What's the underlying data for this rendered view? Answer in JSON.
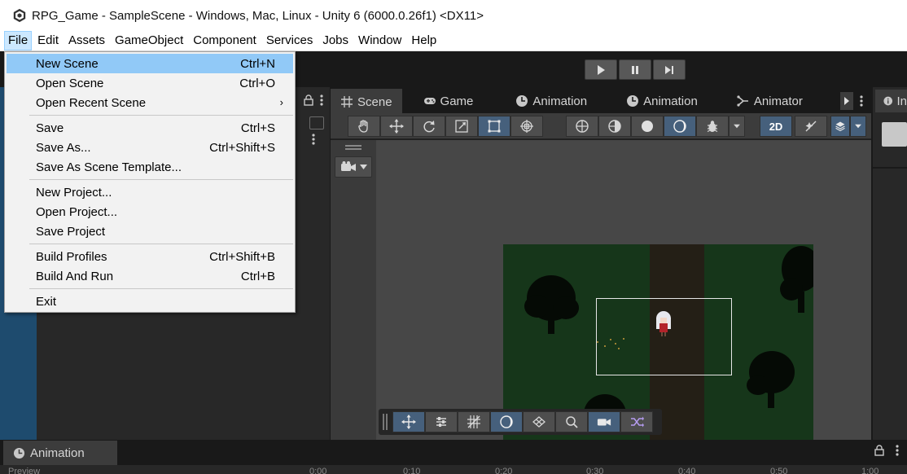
{
  "window": {
    "title": "RPG_Game - SampleScene - Windows, Mac, Linux - Unity 6 (6000.0.26f1) <DX11>"
  },
  "menubar": {
    "items": [
      "File",
      "Edit",
      "Assets",
      "GameObject",
      "Component",
      "Services",
      "Jobs",
      "Window",
      "Help"
    ]
  },
  "file_menu": {
    "groups": [
      [
        {
          "label": "New Scene",
          "shortcut": "Ctrl+N"
        },
        {
          "label": "Open Scene",
          "shortcut": "Ctrl+O"
        },
        {
          "label": "Open Recent Scene",
          "shortcut": ""
        }
      ],
      [
        {
          "label": "Save",
          "shortcut": "Ctrl+S"
        },
        {
          "label": "Save As...",
          "shortcut": "Ctrl+Shift+S"
        },
        {
          "label": "Save As Scene Template...",
          "shortcut": ""
        }
      ],
      [
        {
          "label": "New Project...",
          "shortcut": ""
        },
        {
          "label": "Open Project...",
          "shortcut": ""
        },
        {
          "label": "Save Project",
          "shortcut": ""
        }
      ],
      [
        {
          "label": "Build Profiles",
          "shortcut": "Ctrl+Shift+B"
        },
        {
          "label": "Build And Run",
          "shortcut": "Ctrl+B"
        }
      ],
      [
        {
          "label": "Exit",
          "shortcut": ""
        }
      ]
    ],
    "submenu_arrow": "›"
  },
  "scene_tabs": [
    {
      "label": "Scene",
      "icon": "grid-icon"
    },
    {
      "label": "Game",
      "icon": "gamepad-icon"
    },
    {
      "label": "Animation",
      "icon": "animation-clock-icon"
    },
    {
      "label": "Animation",
      "icon": "animation-clock-icon"
    },
    {
      "label": "Animator",
      "icon": "animator-icon"
    }
  ],
  "scene_toolbar": {
    "toggle_2d": "2D"
  },
  "inspector_tab": {
    "label": "In"
  },
  "bottom_panel": {
    "tab_label": "Animation",
    "preview_label": "Preview",
    "timeline_ticks": [
      "0:00",
      "0:10",
      "0:20",
      "0:30",
      "0:40",
      "0:50",
      "1:00"
    ]
  },
  "colors": {
    "accent_selected": "#46607c",
    "menu_highlight": "#91c9f7",
    "editor_dark": "#191919"
  }
}
